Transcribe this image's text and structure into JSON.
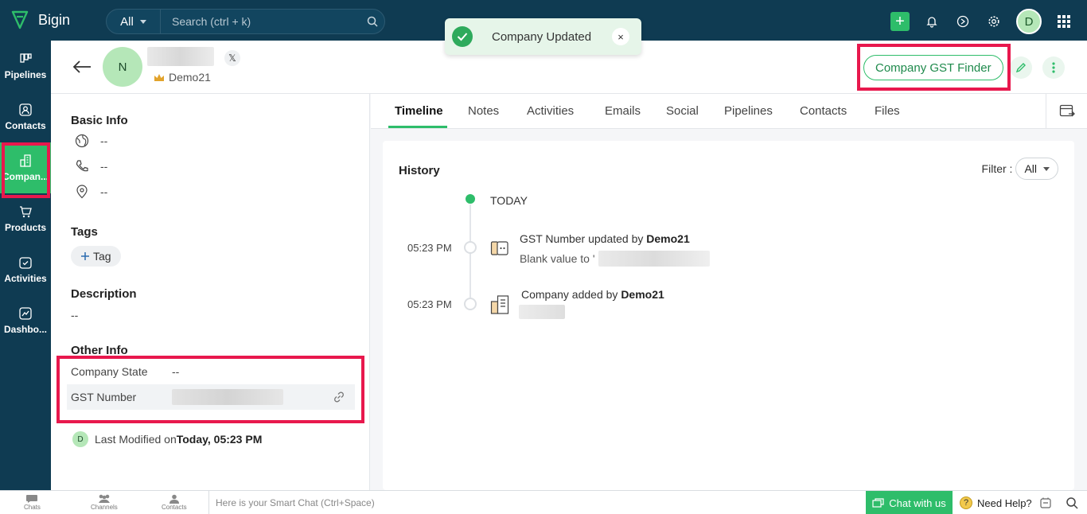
{
  "app": {
    "name": "Bigin"
  },
  "search": {
    "scope": "All",
    "placeholder": "Search (ctrl + k)"
  },
  "topbar": {
    "avatar_initial": "D"
  },
  "leftnav": [
    {
      "label": "Pipelines",
      "icon": "pipelines-icon"
    },
    {
      "label": "Contacts",
      "icon": "contacts-icon"
    },
    {
      "label": "Compan...",
      "icon": "companies-icon",
      "active": true
    },
    {
      "label": "Products",
      "icon": "products-icon"
    },
    {
      "label": "Activities",
      "icon": "activities-icon"
    },
    {
      "label": "Dashbo...",
      "icon": "dashboard-icon"
    }
  ],
  "toast": {
    "message": "Company Updated",
    "close": "×"
  },
  "record": {
    "avatar_initial": "N",
    "owner": "Demo21",
    "social_badge": "𝕏",
    "gst_finder_label": "Company GST Finder"
  },
  "basic_info": {
    "title": "Basic Info",
    "website": "--",
    "phone": "--",
    "address": "--"
  },
  "tags": {
    "title": "Tags",
    "add_label": "Tag"
  },
  "description": {
    "title": "Description",
    "value": "--"
  },
  "other_info": {
    "title": "Other Info",
    "company_state_label": "Company State",
    "company_state_value": "--",
    "gst_number_label": "GST Number"
  },
  "last_modified": {
    "avatar_initial": "D",
    "label": "Last Modified on",
    "when": "Today, 05:23 PM"
  },
  "tabs": [
    "Timeline",
    "Notes",
    "Activities",
    "Emails",
    "Social",
    "Pipelines",
    "Contacts",
    "Files"
  ],
  "history": {
    "title": "History",
    "filter_label": "Filter :",
    "filter_value": "All",
    "today_label": "TODAY",
    "entries": [
      {
        "time": "05:23 PM",
        "title": "GST Number updated by ",
        "user": "Demo21",
        "sub": "Blank value to '"
      },
      {
        "time": "05:23 PM",
        "title": "Company added by ",
        "user": "Demo21"
      }
    ]
  },
  "bottombar": {
    "chats": "Chats",
    "channels": "Channels",
    "contacts": "Contacts",
    "smart_chat_placeholder": "Here is your Smart Chat (Ctrl+Space)",
    "chat_with_us": "Chat with us",
    "need_help": "Need Help?"
  },
  "colors": {
    "navy": "#0f3b52",
    "green": "#2ebd6a",
    "highlight": "#e8184d"
  }
}
